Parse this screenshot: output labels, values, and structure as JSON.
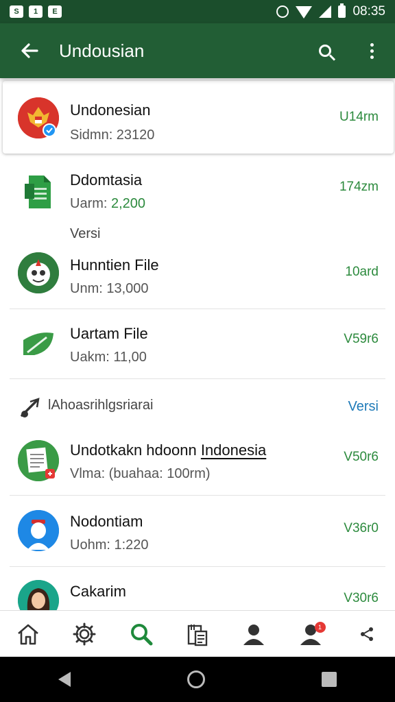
{
  "status_bar": {
    "time": "08:35",
    "left_icons": [
      "S",
      "1",
      "E"
    ]
  },
  "app_bar": {
    "title": "Undousian"
  },
  "items": [
    {
      "title": "Undonesian",
      "subtitle": "Sidmn: 23120",
      "meta": "U14rm",
      "icon": "emblem-icon"
    },
    {
      "title": "Ddomtasia",
      "subtitle_label": "Uarm: ",
      "subtitle_value": "2,200",
      "meta": "174zm",
      "icon": "spreadsheet-icon"
    },
    {
      "title": "Hunntien File",
      "subtitle": "Unm: 13,000",
      "meta": "10ard",
      "icon": "mask-icon"
    },
    {
      "title": "Uartam File",
      "subtitle": "Uakm: 11,00",
      "meta": "V59r6",
      "icon": "leaf-icon"
    },
    {
      "title_prefix": "Undotkakn hdoonn ",
      "title_link": "Indonesia",
      "subtitle": "Vlma: (buahaa: 100rm)",
      "meta": "V50r6",
      "icon": "document-icon"
    },
    {
      "title": "Nodontiam",
      "subtitle": "Uohm: 1:220",
      "meta": "V36r0",
      "icon": "person-icon"
    },
    {
      "title": "Cakarim",
      "subtitle": "",
      "meta": "V30r6",
      "icon": "woman-icon"
    }
  ],
  "section_versi_label": "Versi",
  "section_header": {
    "label": "lAhoasrihlgsriarai",
    "action": "Versi"
  },
  "colors": {
    "primary": "#225e35",
    "status": "#1b4e2c",
    "accent": "#2c8a3d",
    "link": "#1e7ab8"
  },
  "bottom_nav": {
    "badge": "1"
  }
}
